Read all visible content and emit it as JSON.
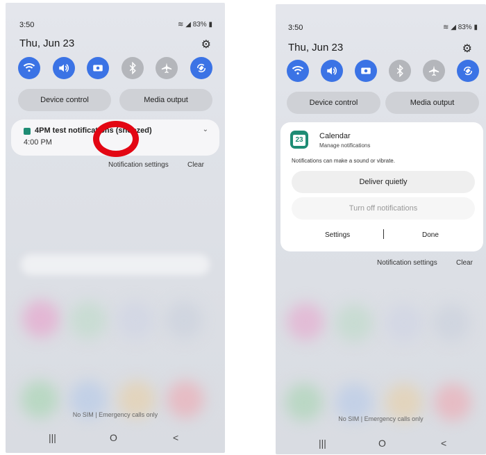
{
  "status": {
    "time": "3:50",
    "battery": "83%"
  },
  "header": {
    "date": "Thu, Jun 23"
  },
  "quick_settings": {
    "tiles": [
      {
        "icon": "wifi-icon",
        "state": "on"
      },
      {
        "icon": "sound-icon",
        "state": "on"
      },
      {
        "icon": "screen-record-icon",
        "state": "on"
      },
      {
        "icon": "bluetooth-icon",
        "state": "off"
      },
      {
        "icon": "airplane-icon",
        "state": "off"
      },
      {
        "icon": "auto-rotate-icon",
        "state": "on"
      }
    ],
    "device_control": "Device control",
    "media_output": "Media output"
  },
  "notification": {
    "title": "4PM test notifications (snoozed)",
    "time": "4:00 PM"
  },
  "notification_actions": {
    "settings": "Notification settings",
    "clear": "Clear"
  },
  "calendar_card": {
    "app_icon_day": "23",
    "app_name": "Calendar",
    "manage": "Manage notifications",
    "description": "Notifications can make a sound or vibrate.",
    "deliver_quietly": "Deliver quietly",
    "turn_off": "Turn off notifications",
    "settings": "Settings",
    "done": "Done"
  },
  "footer": {
    "no_sim": "No SIM | Emergency calls only"
  },
  "nav": {
    "recents": "|||",
    "home": "O",
    "back": "<"
  },
  "colors": {
    "tile_on": "#3b73e5",
    "tile_off": "#b4b6bb",
    "highlight_circle": "#e30613",
    "calendar_green": "#1e8c74"
  }
}
